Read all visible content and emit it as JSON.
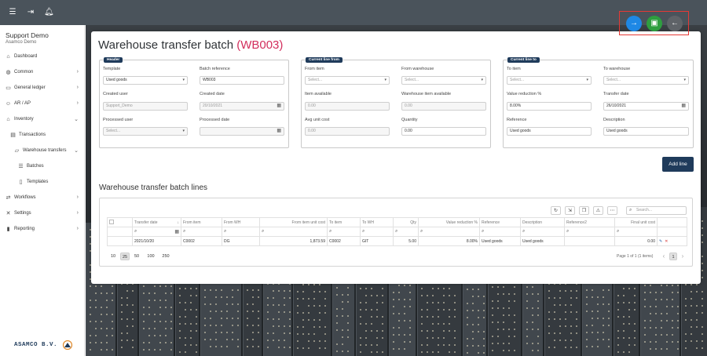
{
  "topbar": {
    "icons": [
      "menu-icon",
      "logout-icon",
      "bell-icon"
    ]
  },
  "sidebar": {
    "company_name": "Support Demo",
    "company_sub": "Asamco Demo",
    "items": [
      {
        "label": "Dashboard",
        "icon": "home-icon"
      },
      {
        "label": "Common",
        "icon": "globe-icon"
      },
      {
        "label": "General ledger",
        "icon": "book-icon"
      },
      {
        "label": "AR / AP",
        "icon": "people-icon"
      },
      {
        "label": "Inventory",
        "icon": "warehouse-icon"
      },
      {
        "label": "Transactions",
        "icon": "transactions-icon"
      },
      {
        "label": "Warehouse transfers",
        "icon": "truck-icon"
      },
      {
        "label": "Batches",
        "icon": "database-icon"
      },
      {
        "label": "Templates",
        "icon": "document-icon"
      },
      {
        "label": "Workflows",
        "icon": "workflow-icon"
      },
      {
        "label": "Settings",
        "icon": "tools-icon"
      },
      {
        "label": "Reporting",
        "icon": "report-icon"
      }
    ],
    "footer_logo": "ASAMCO B.V."
  },
  "page": {
    "title": "Warehouse transfer batch",
    "code": "(WB003)"
  },
  "actions": {
    "colors": {
      "next": "#1e88e5",
      "save": "#2e9e3f",
      "back": "#5f6368"
    }
  },
  "header_group": {
    "legend": "Header",
    "template_label": "Template",
    "template_value": "Used goods",
    "batch_reference_label": "Batch reference",
    "batch_reference_value": "WB003",
    "created_user_label": "Created user",
    "created_user_value": "Support_Demo",
    "created_date_label": "Created date",
    "created_date_value": "20/10/2021",
    "processed_user_label": "Processed user",
    "processed_user_placeholder": "Select...",
    "processed_date_label": "Processed date",
    "processed_date_value": ""
  },
  "line_from": {
    "legend": "Current line from",
    "from_item_label": "From item",
    "from_item_placeholder": "Select...",
    "from_warehouse_label": "From warehouse",
    "from_warehouse_placeholder": "Select...",
    "item_available_label": "Item available",
    "item_available_value": "0.00",
    "warehouse_item_available_label": "Warehouse item available",
    "warehouse_item_available_value": "0.00",
    "avg_unit_cost_label": "Avg unit cost",
    "avg_unit_cost_value": "0.00",
    "quantity_label": "Quantity",
    "quantity_value": "0.00"
  },
  "line_to": {
    "legend": "Current line to",
    "to_item_label": "To item",
    "to_item_placeholder": "Select...",
    "to_warehouse_label": "To warehouse",
    "to_warehouse_placeholder": "Select...",
    "value_reduction_label": "Value reduction %",
    "value_reduction_value": "8.00%",
    "transfer_date_label": "Transfer date",
    "transfer_date_value": "26/10/2021",
    "reference_label": "Reference",
    "reference_value": "Used goods",
    "description_label": "Description",
    "description_value": "Used goods"
  },
  "add_line_label": "Add line",
  "lines": {
    "title": "Warehouse transfer batch lines",
    "search_placeholder": "Search...",
    "toolbar_icons": [
      "refresh-icon",
      "export-icon",
      "copy-icon",
      "warning-icon",
      "more-icon"
    ],
    "columns": [
      "Transfer date",
      "From item",
      "From WH",
      "From item unit cost",
      "To item",
      "To WH",
      "Qty",
      "Value reduction %",
      "Reference",
      "Description",
      "Reference2",
      "Final unit cost"
    ],
    "rows": [
      {
        "transfer_date": "2021/10/20",
        "from_item": "C0002",
        "from_wh": "DG",
        "from_item_unit_cost": "1,873.59",
        "to_item": "C0002",
        "to_wh": "GIT",
        "qty": "5.00",
        "value_reduction": "8.00%",
        "reference": "Used goods",
        "description": "Used goods",
        "reference2": "",
        "final_unit_cost": "0.00"
      }
    ],
    "page_sizes": [
      "10",
      "25",
      "50",
      "100",
      "250"
    ],
    "active_page_size": "25",
    "page_info": "Page 1 of 1 (1 items)",
    "current_page": "1"
  }
}
